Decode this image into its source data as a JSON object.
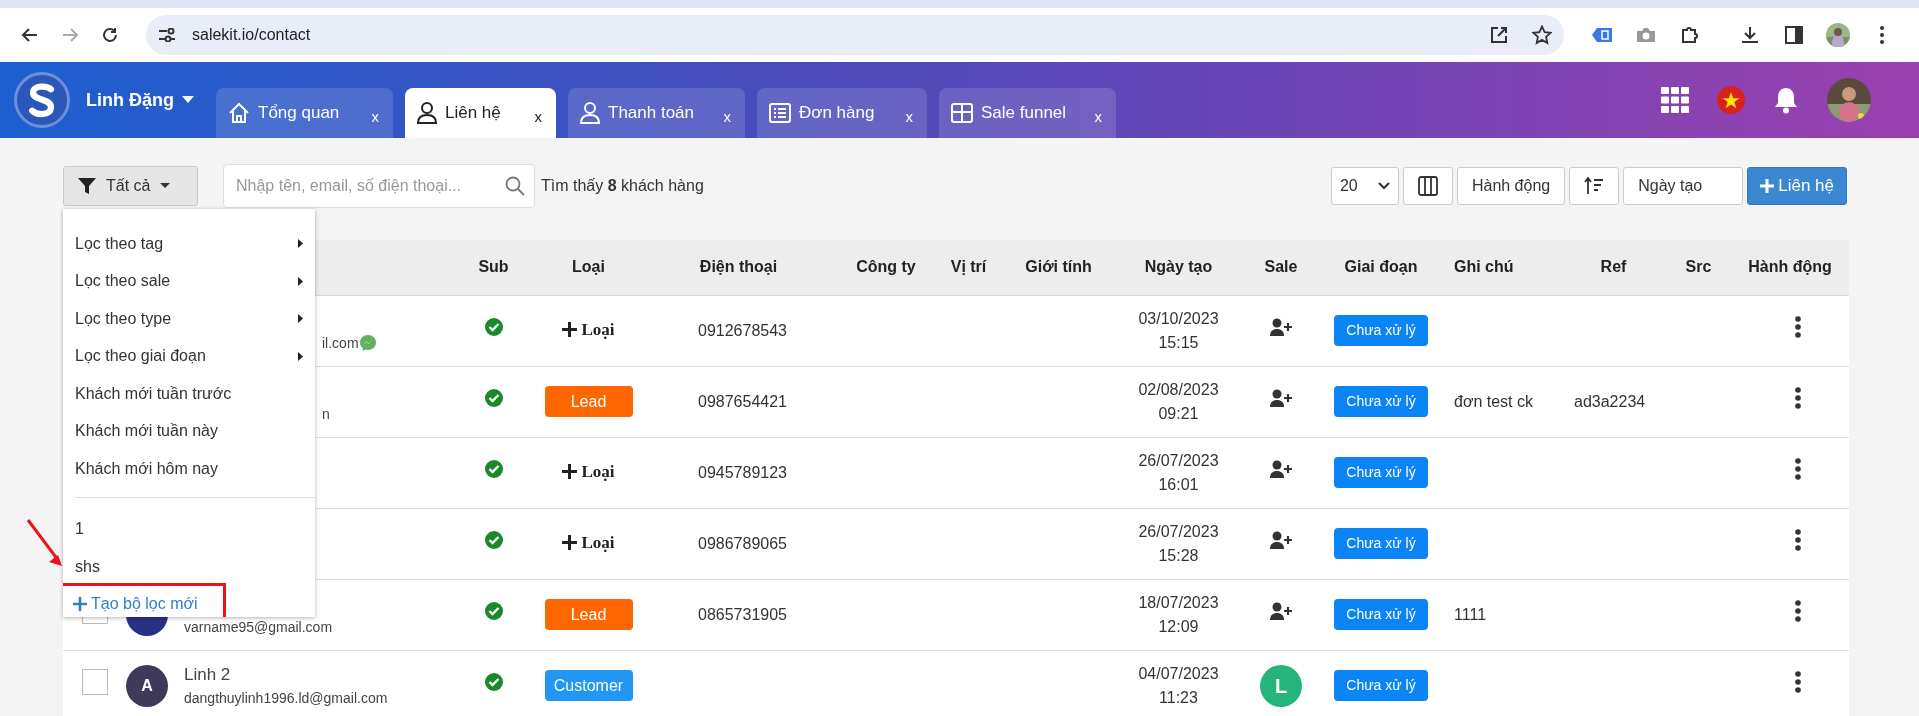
{
  "browser": {
    "url": "salekit.io/contact"
  },
  "header": {
    "user": "Linh Đặng",
    "tabs": [
      {
        "label": "Tổng quan",
        "selected": false,
        "close": "x"
      },
      {
        "label": "Liên hệ",
        "selected": true,
        "close": "x"
      },
      {
        "label": "Thanh toán",
        "selected": false,
        "close": "x"
      },
      {
        "label": "Đơn hàng",
        "selected": false,
        "close": "x"
      },
      {
        "label": "Sale funnel",
        "selected": false,
        "close": "x"
      }
    ]
  },
  "toolbar": {
    "filter": "Tất cả",
    "search": {
      "placeholder": "Nhập tên, email, số điện thoại..."
    },
    "result": "Tìm thấy **8** khách hàng",
    "page_size": "20",
    "actions": "Hành động",
    "sort_field": "Ngày tạo",
    "add_button": "Liên hệ"
  },
  "filter_menu": [
    {
      "kind": "submenu",
      "label": "Lọc theo tag"
    },
    {
      "kind": "submenu",
      "label": "Lọc theo sale"
    },
    {
      "kind": "submenu",
      "label": "Lọc theo type"
    },
    {
      "kind": "submenu",
      "label": "Lọc theo giai đoạn"
    },
    {
      "kind": "item",
      "label": "Khách mới tuần trước"
    },
    {
      "kind": "item",
      "label": "Khách mới tuần này"
    },
    {
      "kind": "item",
      "label": "Khách mới hôm nay"
    },
    {
      "kind": "divider"
    },
    {
      "kind": "item",
      "label": "1"
    },
    {
      "kind": "item",
      "label": "shs"
    },
    {
      "kind": "action",
      "label": "Tạo bộ lọc mới",
      "highlighted": true
    }
  ],
  "table": {
    "columns": [
      "Sub",
      "Loại",
      "Điện thoại",
      "Công ty",
      "Vị trí",
      "Giới tính",
      "Ngày tạo",
      "Sale",
      "Giai đoạn",
      "Ghi chú",
      "Ref",
      "Src",
      "Hành động"
    ],
    "rows": [
      {
        "covered": true,
        "email": "il.com",
        "messenger": true,
        "sub": true,
        "type": {
          "kind": "add",
          "label": "Loại"
        },
        "phone": "0912678543",
        "date": "03/10/2023",
        "time": "15:15",
        "sale": {
          "kind": "assign"
        },
        "stage": "Chưa xử lý"
      },
      {
        "covered": true,
        "email": "n",
        "messenger": false,
        "sub": true,
        "type": {
          "kind": "badge",
          "label": "Lead",
          "color": "#ff6600"
        },
        "phone": "0987654421",
        "date": "02/08/2023",
        "time": "09:21",
        "sale": {
          "kind": "assign"
        },
        "stage": "Chưa xử lý",
        "note": "đơn test ck",
        "ref": "ad3a2234"
      },
      {
        "covered": true,
        "sub": true,
        "type": {
          "kind": "add",
          "label": "Loại"
        },
        "phone": "0945789123",
        "date": "26/07/2023",
        "time": "16:01",
        "sale": {
          "kind": "assign"
        },
        "stage": "Chưa xử lý"
      },
      {
        "covered": true,
        "sub": true,
        "type": {
          "kind": "add",
          "label": "Loại"
        },
        "phone": "0986789065",
        "date": "26/07/2023",
        "time": "15:28",
        "sale": {
          "kind": "assign"
        },
        "stage": "Chưa xử lý"
      },
      {
        "covered": false,
        "checked": false,
        "email": "varname95@gmail.com",
        "messenger": false,
        "sub": true,
        "type": {
          "kind": "badge",
          "label": "Lead",
          "color": "#ff6600"
        },
        "phone": "0865731905",
        "date": "18/07/2023",
        "time": "12:09",
        "sale": {
          "kind": "assign"
        },
        "stage": "Chưa xử lý",
        "note": "1111"
      },
      {
        "covered": false,
        "checked": false,
        "avatar": "A",
        "name": "Linh 2",
        "email": "dangthuylinh1996.ld@gmail.com",
        "messenger": false,
        "sub": true,
        "type": {
          "kind": "badge",
          "label": "Customer",
          "color": "#2196f3"
        },
        "date": "04/07/2023",
        "time": "11:23",
        "sale": {
          "kind": "avatar",
          "letter": "L",
          "color": "#26b47c"
        },
        "stage": "Chưa xử lý"
      }
    ]
  }
}
